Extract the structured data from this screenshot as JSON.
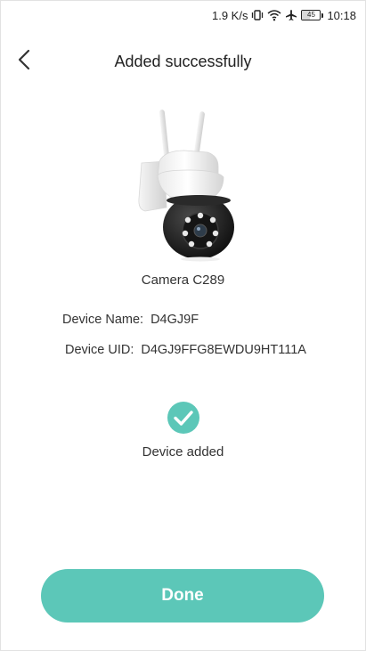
{
  "status_bar": {
    "speed": "1.9 K/s",
    "battery": "45",
    "battery_level_percent": 45,
    "time": "10:18",
    "icons": [
      "vibrate-icon",
      "wifi-icon",
      "airplane-icon",
      "battery-icon"
    ]
  },
  "header": {
    "title": "Added successfully",
    "back_icon": "chevron-left-icon"
  },
  "device": {
    "model": "Camera C289",
    "name_label": "Device Name:",
    "name_value": "D4GJ9F",
    "uid_label": "Device UID:",
    "uid_value": "D4GJ9FFG8EWDU9HT111A"
  },
  "status": {
    "icon": "check-circle-icon",
    "text": "Device added"
  },
  "actions": {
    "done_label": "Done"
  },
  "colors": {
    "accent": "#5cc7b8",
    "text": "#333333",
    "background": "#ffffff"
  }
}
